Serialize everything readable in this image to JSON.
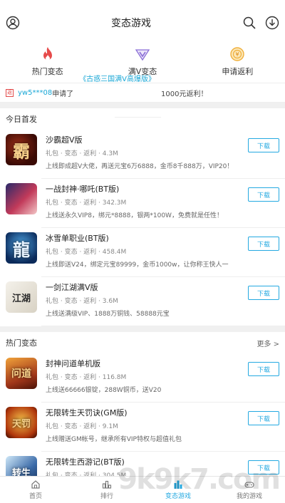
{
  "header": {
    "title": "变态游戏"
  },
  "quicknav": [
    {
      "label": "热门变态",
      "icon": "flame-icon"
    },
    {
      "label": "满V变态",
      "icon": "v-badge-icon"
    },
    {
      "label": "申请返利",
      "icon": "rebate-coin-icon"
    }
  ],
  "notice": {
    "badge": "返",
    "user": "yw5***08",
    "mid": " 申请了",
    "game": "《古惑三国满V高爆版》",
    "tail": "1000元返利！"
  },
  "today": {
    "title": "今日首发",
    "games": [
      {
        "name": "沙霸超V版",
        "meta": "礼包 · 变态 · 返利 · 4.3M",
        "desc": "上线即成超V大佬，再送元宝6万6888，金币8千888万，VIP20！",
        "thumb": "霸",
        "button": "下载"
      },
      {
        "name": "一战封神·哪吒(BT版)",
        "meta": "礼包 · 变态 · 返利 · 342.3M",
        "desc": "上线送永久VIP8，绑元*8888，银两*100W，免费就是任性！",
        "thumb": "",
        "button": "下载"
      },
      {
        "name": "冰雪单职业(BT版)",
        "meta": "礼包 · 变态 · 返利 · 458.4M",
        "desc": "上线即送V24，绑定元宝89999，金币1000w，让你称王快人一",
        "thumb": "龍",
        "button": "下载"
      },
      {
        "name": "一剑江湖满V版",
        "meta": "礼包 · 变态 · 返利 · 3.6M",
        "desc": "上线送满级VIP、1888万铜钱、58888元宝",
        "thumb": "江湖",
        "button": "下载"
      }
    ]
  },
  "hot": {
    "title": "热门变态",
    "more": "更多 >",
    "games": [
      {
        "name": "封神问道单机版",
        "meta": "礼包 · 变态 · 返利 · 116.8M",
        "desc": "上线送66666银锭，288W铜币，送V20",
        "thumb": "问道",
        "button": "下载"
      },
      {
        "name": "无限转生天罚诀(GM版)",
        "meta": "礼包 · 变态 · 返利 · 9.1M",
        "desc": "上线赠送GM帐号，继承所有VIP特权与超值礼包",
        "thumb": "天罚",
        "button": "下载"
      },
      {
        "name": "无限转生西游记(BT版)",
        "meta": "礼包 · 变态 · 返利 · 304.5M",
        "desc": "",
        "thumb": "转生",
        "button": "下载"
      }
    ]
  },
  "tabbar": [
    {
      "label": "首页",
      "icon": "home-icon",
      "active": false
    },
    {
      "label": "排行",
      "icon": "ranking-icon",
      "active": false
    },
    {
      "label": "变态游戏",
      "icon": "game-bars-icon",
      "active": true
    },
    {
      "label": "我的游戏",
      "icon": "gamepad-icon",
      "active": false
    }
  ],
  "watermark": "9k9k7.com",
  "colors": {
    "accent": "#24a9e1",
    "notice_link": "#19a7d6",
    "flame": "#e64b4b",
    "vbadge": "#8b6fd6",
    "rebate": "#f0b03c"
  }
}
